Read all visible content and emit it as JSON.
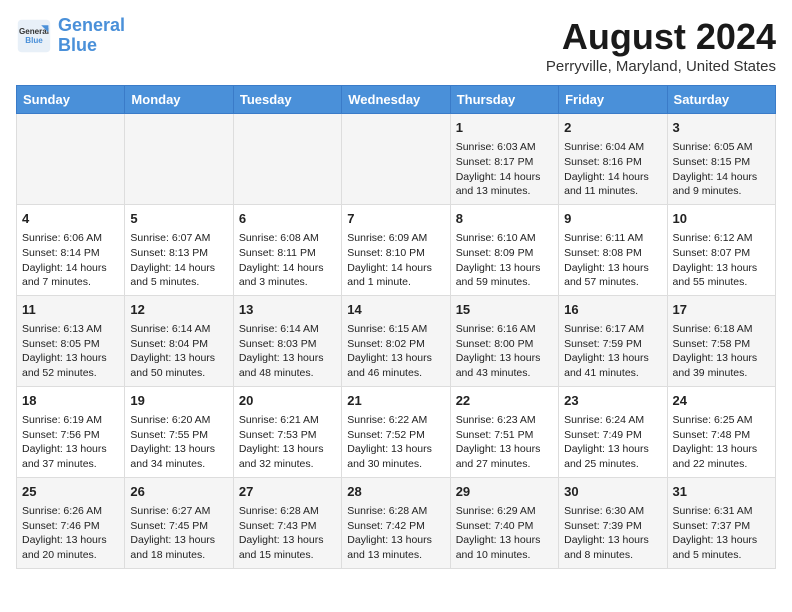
{
  "header": {
    "logo_line1": "General",
    "logo_line2": "Blue",
    "month_year": "August 2024",
    "location": "Perryville, Maryland, United States"
  },
  "weekdays": [
    "Sunday",
    "Monday",
    "Tuesday",
    "Wednesday",
    "Thursday",
    "Friday",
    "Saturday"
  ],
  "weeks": [
    [
      {
        "day": "",
        "content": ""
      },
      {
        "day": "",
        "content": ""
      },
      {
        "day": "",
        "content": ""
      },
      {
        "day": "",
        "content": ""
      },
      {
        "day": "1",
        "content": "Sunrise: 6:03 AM\nSunset: 8:17 PM\nDaylight: 14 hours\nand 13 minutes."
      },
      {
        "day": "2",
        "content": "Sunrise: 6:04 AM\nSunset: 8:16 PM\nDaylight: 14 hours\nand 11 minutes."
      },
      {
        "day": "3",
        "content": "Sunrise: 6:05 AM\nSunset: 8:15 PM\nDaylight: 14 hours\nand 9 minutes."
      }
    ],
    [
      {
        "day": "4",
        "content": "Sunrise: 6:06 AM\nSunset: 8:14 PM\nDaylight: 14 hours\nand 7 minutes."
      },
      {
        "day": "5",
        "content": "Sunrise: 6:07 AM\nSunset: 8:13 PM\nDaylight: 14 hours\nand 5 minutes."
      },
      {
        "day": "6",
        "content": "Sunrise: 6:08 AM\nSunset: 8:11 PM\nDaylight: 14 hours\nand 3 minutes."
      },
      {
        "day": "7",
        "content": "Sunrise: 6:09 AM\nSunset: 8:10 PM\nDaylight: 14 hours\nand 1 minute."
      },
      {
        "day": "8",
        "content": "Sunrise: 6:10 AM\nSunset: 8:09 PM\nDaylight: 13 hours\nand 59 minutes."
      },
      {
        "day": "9",
        "content": "Sunrise: 6:11 AM\nSunset: 8:08 PM\nDaylight: 13 hours\nand 57 minutes."
      },
      {
        "day": "10",
        "content": "Sunrise: 6:12 AM\nSunset: 8:07 PM\nDaylight: 13 hours\nand 55 minutes."
      }
    ],
    [
      {
        "day": "11",
        "content": "Sunrise: 6:13 AM\nSunset: 8:05 PM\nDaylight: 13 hours\nand 52 minutes."
      },
      {
        "day": "12",
        "content": "Sunrise: 6:14 AM\nSunset: 8:04 PM\nDaylight: 13 hours\nand 50 minutes."
      },
      {
        "day": "13",
        "content": "Sunrise: 6:14 AM\nSunset: 8:03 PM\nDaylight: 13 hours\nand 48 minutes."
      },
      {
        "day": "14",
        "content": "Sunrise: 6:15 AM\nSunset: 8:02 PM\nDaylight: 13 hours\nand 46 minutes."
      },
      {
        "day": "15",
        "content": "Sunrise: 6:16 AM\nSunset: 8:00 PM\nDaylight: 13 hours\nand 43 minutes."
      },
      {
        "day": "16",
        "content": "Sunrise: 6:17 AM\nSunset: 7:59 PM\nDaylight: 13 hours\nand 41 minutes."
      },
      {
        "day": "17",
        "content": "Sunrise: 6:18 AM\nSunset: 7:58 PM\nDaylight: 13 hours\nand 39 minutes."
      }
    ],
    [
      {
        "day": "18",
        "content": "Sunrise: 6:19 AM\nSunset: 7:56 PM\nDaylight: 13 hours\nand 37 minutes."
      },
      {
        "day": "19",
        "content": "Sunrise: 6:20 AM\nSunset: 7:55 PM\nDaylight: 13 hours\nand 34 minutes."
      },
      {
        "day": "20",
        "content": "Sunrise: 6:21 AM\nSunset: 7:53 PM\nDaylight: 13 hours\nand 32 minutes."
      },
      {
        "day": "21",
        "content": "Sunrise: 6:22 AM\nSunset: 7:52 PM\nDaylight: 13 hours\nand 30 minutes."
      },
      {
        "day": "22",
        "content": "Sunrise: 6:23 AM\nSunset: 7:51 PM\nDaylight: 13 hours\nand 27 minutes."
      },
      {
        "day": "23",
        "content": "Sunrise: 6:24 AM\nSunset: 7:49 PM\nDaylight: 13 hours\nand 25 minutes."
      },
      {
        "day": "24",
        "content": "Sunrise: 6:25 AM\nSunset: 7:48 PM\nDaylight: 13 hours\nand 22 minutes."
      }
    ],
    [
      {
        "day": "25",
        "content": "Sunrise: 6:26 AM\nSunset: 7:46 PM\nDaylight: 13 hours\nand 20 minutes."
      },
      {
        "day": "26",
        "content": "Sunrise: 6:27 AM\nSunset: 7:45 PM\nDaylight: 13 hours\nand 18 minutes."
      },
      {
        "day": "27",
        "content": "Sunrise: 6:28 AM\nSunset: 7:43 PM\nDaylight: 13 hours\nand 15 minutes."
      },
      {
        "day": "28",
        "content": "Sunrise: 6:28 AM\nSunset: 7:42 PM\nDaylight: 13 hours\nand 13 minutes."
      },
      {
        "day": "29",
        "content": "Sunrise: 6:29 AM\nSunset: 7:40 PM\nDaylight: 13 hours\nand 10 minutes."
      },
      {
        "day": "30",
        "content": "Sunrise: 6:30 AM\nSunset: 7:39 PM\nDaylight: 13 hours\nand 8 minutes."
      },
      {
        "day": "31",
        "content": "Sunrise: 6:31 AM\nSunset: 7:37 PM\nDaylight: 13 hours\nand 5 minutes."
      }
    ]
  ]
}
